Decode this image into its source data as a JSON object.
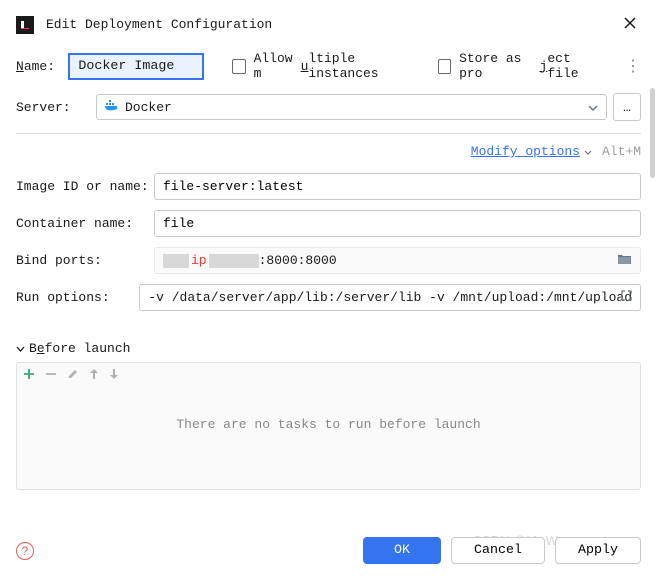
{
  "title": "Edit Deployment Configuration",
  "name": {
    "label_pre": "N",
    "label_post": "ame:",
    "value": "Docker Image"
  },
  "allow_multiple": {
    "pre": "Allow m",
    "u": "u",
    "post": "ltiple instances"
  },
  "store_project": {
    "pre": "Store as pro",
    "u": "j",
    "post": "ect file"
  },
  "server": {
    "label": "Server:",
    "value": "Docker",
    "ellipsis": "…"
  },
  "modify": {
    "text": "Modify options",
    "shortcut": "Alt+M"
  },
  "fields": {
    "image_label": "Image ID or name:",
    "image_value": "file-server:latest",
    "container_label": "Container name:",
    "container_value": "file",
    "bind_label": "Bind ports:",
    "bind_ip": "ip",
    "bind_suffix": ":8000:8000",
    "runopt_label": "Run options:",
    "runopt_value": "-v /data/server/app/lib:/server/lib -v /mnt/upload:/mnt/upload"
  },
  "section": {
    "pre": "B",
    "u": "e",
    "post": "fore launch",
    "empty": "There are no tasks to run before launch"
  },
  "footer": {
    "ok": "OK",
    "cancel": "Cancel",
    "apply": "Apply"
  },
  "watermark": "CSDN @Mr-Wanter"
}
